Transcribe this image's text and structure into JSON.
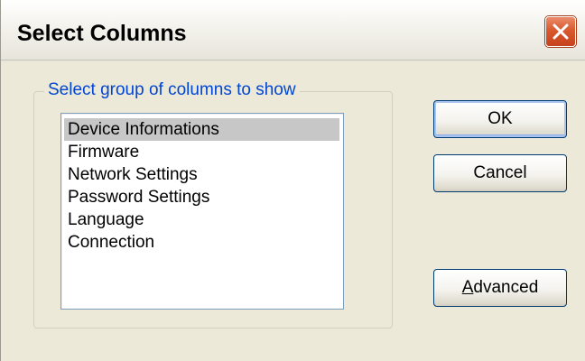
{
  "window": {
    "title": "Select Columns"
  },
  "group": {
    "legend": "Select group of columns to show"
  },
  "list": {
    "items": [
      {
        "label": "Device Informations",
        "selected": true
      },
      {
        "label": "Firmware",
        "selected": false
      },
      {
        "label": "Network Settings",
        "selected": false
      },
      {
        "label": "Password Settings",
        "selected": false
      },
      {
        "label": "Language",
        "selected": false
      },
      {
        "label": "Connection",
        "selected": false
      }
    ]
  },
  "buttons": {
    "ok_label": "OK",
    "cancel_label": "Cancel",
    "advanced_mnemonic": "A",
    "advanced_rest": "dvanced"
  },
  "icons": {
    "close": "close-icon"
  },
  "colors": {
    "window_bg": "#ECE9D8",
    "legend_text": "#0046D5",
    "close_button": "#D95A2F",
    "selection": "#C7C7C7"
  }
}
